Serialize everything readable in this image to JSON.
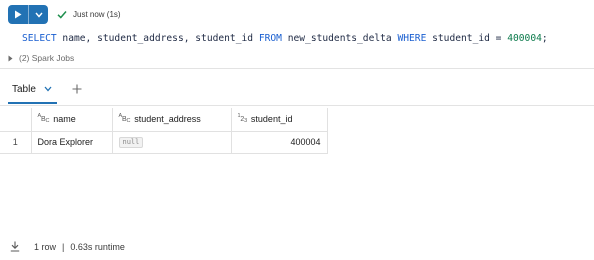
{
  "toolbar": {
    "run_icon": "play-icon",
    "menu_icon": "chevron-down-icon",
    "status_icon": "check-icon",
    "status_text": "Just now (1s)",
    "accent_color": "#2272b4",
    "success_color": "#1f8f4e"
  },
  "code": {
    "kw_select": "SELECT",
    "columns_text": " name, student_address, student_id ",
    "kw_from": "FROM",
    "table_text": " new_students_delta ",
    "kw_where": "WHERE",
    "condition_text": " student_id ",
    "operator": "=",
    "space": " ",
    "value": "400004",
    "terminator": ";"
  },
  "spark_jobs": {
    "icon": "caret-right-icon",
    "label": "(2) Spark Jobs"
  },
  "tabs": {
    "active_label": "Table",
    "dropdown_icon": "chevron-down-icon",
    "add_icon": "plus-icon"
  },
  "table": {
    "columns": [
      {
        "type": "string",
        "name": "name"
      },
      {
        "type": "string",
        "name": "student_address"
      },
      {
        "type": "integer",
        "name": "student_id"
      }
    ],
    "rows": [
      {
        "index": "1",
        "name": "Dora Explorer",
        "student_address": "null",
        "student_id": "400004"
      }
    ]
  },
  "footer": {
    "download_icon": "download-icon",
    "row_count": "1 row",
    "separator": "|",
    "runtime": "0.63s runtime"
  }
}
